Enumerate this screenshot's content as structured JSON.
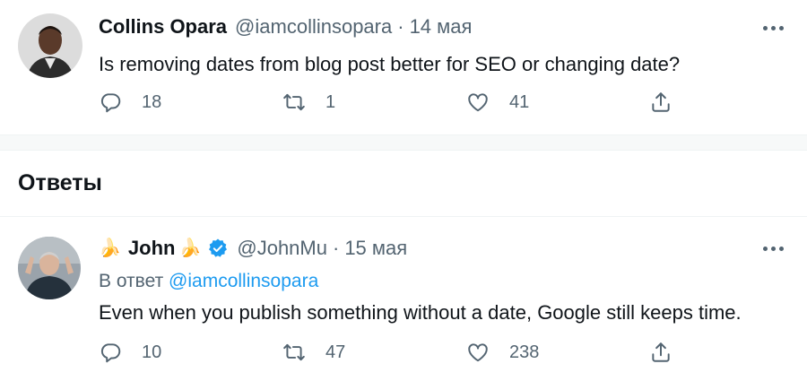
{
  "tweets": [
    {
      "name": "Collins Opara",
      "handle": "@iamcollinsopara",
      "date": "14 мая",
      "text": "Is removing dates from blog post better for SEO or changing date?",
      "replies": "18",
      "retweets": "1",
      "likes": "41",
      "icons": {
        "reply": "reply-icon",
        "retweet": "retweet-icon",
        "like": "heart-icon",
        "share": "share-icon",
        "more": "more-icon"
      }
    },
    {
      "name_prefix_emoji": "🍌",
      "name": "John",
      "name_suffix_emoji": "🍌",
      "verified": true,
      "handle": "@JohnMu",
      "date": "15 мая",
      "reply_to_label": "В ответ",
      "reply_to_handle": "@iamcollinsopara",
      "text": "Even when you publish something without a date, Google still keeps time.",
      "replies": "10",
      "retweets": "47",
      "likes": "238"
    }
  ],
  "section": {
    "title": "Ответы"
  },
  "colors": {
    "accent": "#1d9bf0",
    "secondary_text": "#536471",
    "primary_text": "#0f1419"
  },
  "separator": "·"
}
